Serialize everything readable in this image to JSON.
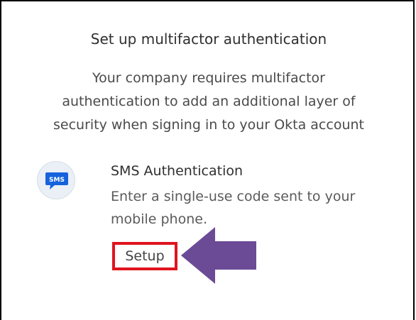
{
  "title": "Set up multifactor authentication",
  "description_lines": [
    "Your company requires multifactor",
    "authentication to add an additional layer of",
    "security when signing in to your Okta account"
  ],
  "factor": {
    "icon_text": "SMS",
    "icon": "sms-chat-bubble-icon",
    "name": "SMS Authentication",
    "desc_lines": [
      "Enter a single-use code sent to your",
      "mobile phone."
    ],
    "setup_label": "Setup"
  },
  "colors": {
    "icon_bubble": "#1662dd",
    "highlight_box": "#e0141e",
    "arrow": "#6b4a96"
  }
}
